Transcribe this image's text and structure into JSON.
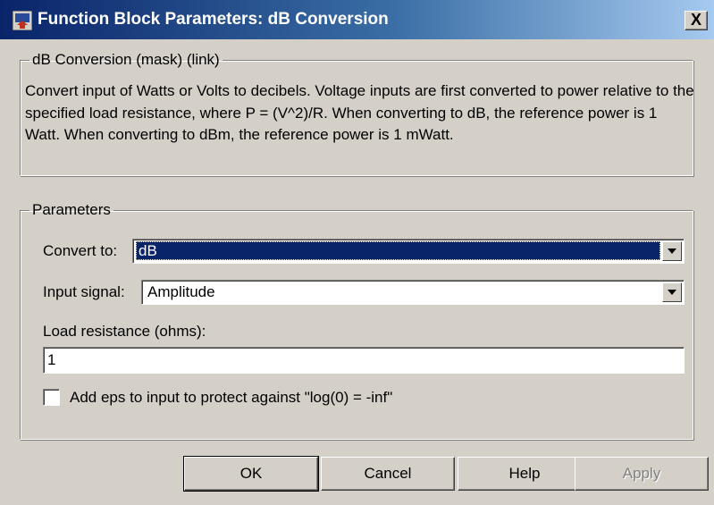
{
  "window": {
    "title": "Function Block Parameters: dB Conversion",
    "close_glyph": "X"
  },
  "description_group": {
    "legend": "dB Conversion (mask) (link)",
    "text": "Convert input of Watts or Volts to decibels. Voltage inputs are first converted to power relative to the specified load resistance, where P = (V^2)/R.  When converting to dB, the reference power is 1 Watt. When converting to dBm, the reference power is 1 mWatt."
  },
  "parameters": {
    "legend": "Parameters",
    "convert_to": {
      "label": "Convert to:",
      "value": "dB"
    },
    "input_signal": {
      "label": "Input signal:",
      "value": "Amplitude"
    },
    "load_resistance": {
      "label": "Load resistance (ohms):",
      "value": "1"
    },
    "add_eps": {
      "label": "Add  eps to input to protect against  \"log(0) = -inf\"",
      "checked": false
    }
  },
  "buttons": {
    "ok": "OK",
    "cancel": "Cancel",
    "help": "Help",
    "apply": "Apply"
  },
  "colors": {
    "title_gradient_start": "#0a246a",
    "title_gradient_end": "#a6caf0",
    "window_bg": "#d4d0c8",
    "selection": "#0a246a"
  },
  "icons": {
    "app_icon": "simulink-block-icon",
    "dropdown_arrow": "chevron-down-icon"
  }
}
